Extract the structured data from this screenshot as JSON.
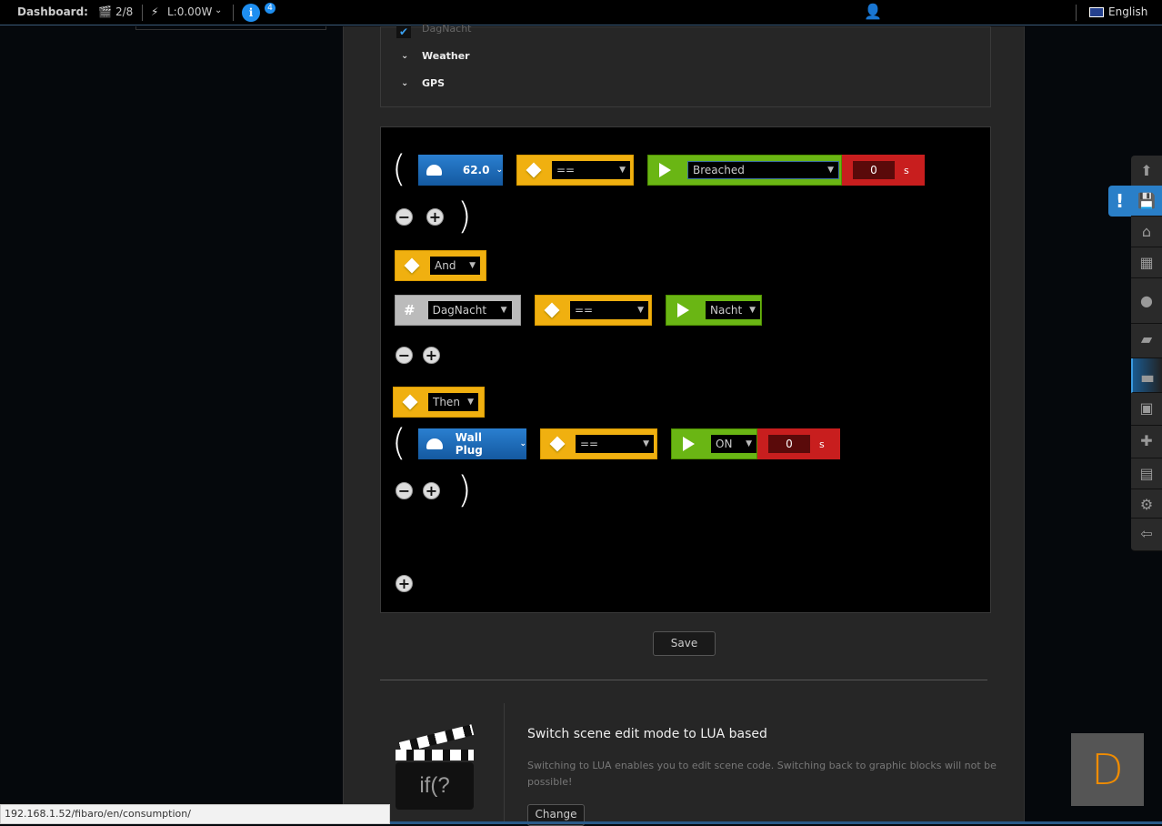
{
  "topbar": {
    "dashboard_label": "Dashboard:",
    "scenes": "2/8",
    "power": "L:0.00W",
    "info_badge": "4",
    "language": "English"
  },
  "sidebar_list": {
    "checked_item": "DagNacht",
    "items": [
      "Weather",
      "GPS"
    ]
  },
  "conditions": {
    "row1": {
      "device": "62.0",
      "operator": "==",
      "value": "Breached",
      "delay": "0",
      "unit": "s"
    },
    "and_label": "And",
    "row2": {
      "variable": "DagNacht",
      "operator": "==",
      "value": "Nacht"
    },
    "then_label": "Then",
    "row3": {
      "device": "Wall Plug",
      "operator": "==",
      "value": "ON",
      "delay": "0",
      "unit": "s"
    }
  },
  "save_label": "Save",
  "lua": {
    "title": "Switch scene edit mode to LUA based",
    "description": "Switching to LUA enables you to edit scene code. Switching back to graphic blocks will not be possible!",
    "button": "Change",
    "icon_text": "if(?"
  },
  "status_url": "192.168.1.52/fibaro/en/consumption/",
  "corner_badge": "D",
  "right_nav": [
    "up",
    "save",
    "home",
    "rooms",
    "lights",
    "scenes",
    "consumption",
    "backup",
    "plugins",
    "panels",
    "settings",
    "logout"
  ]
}
